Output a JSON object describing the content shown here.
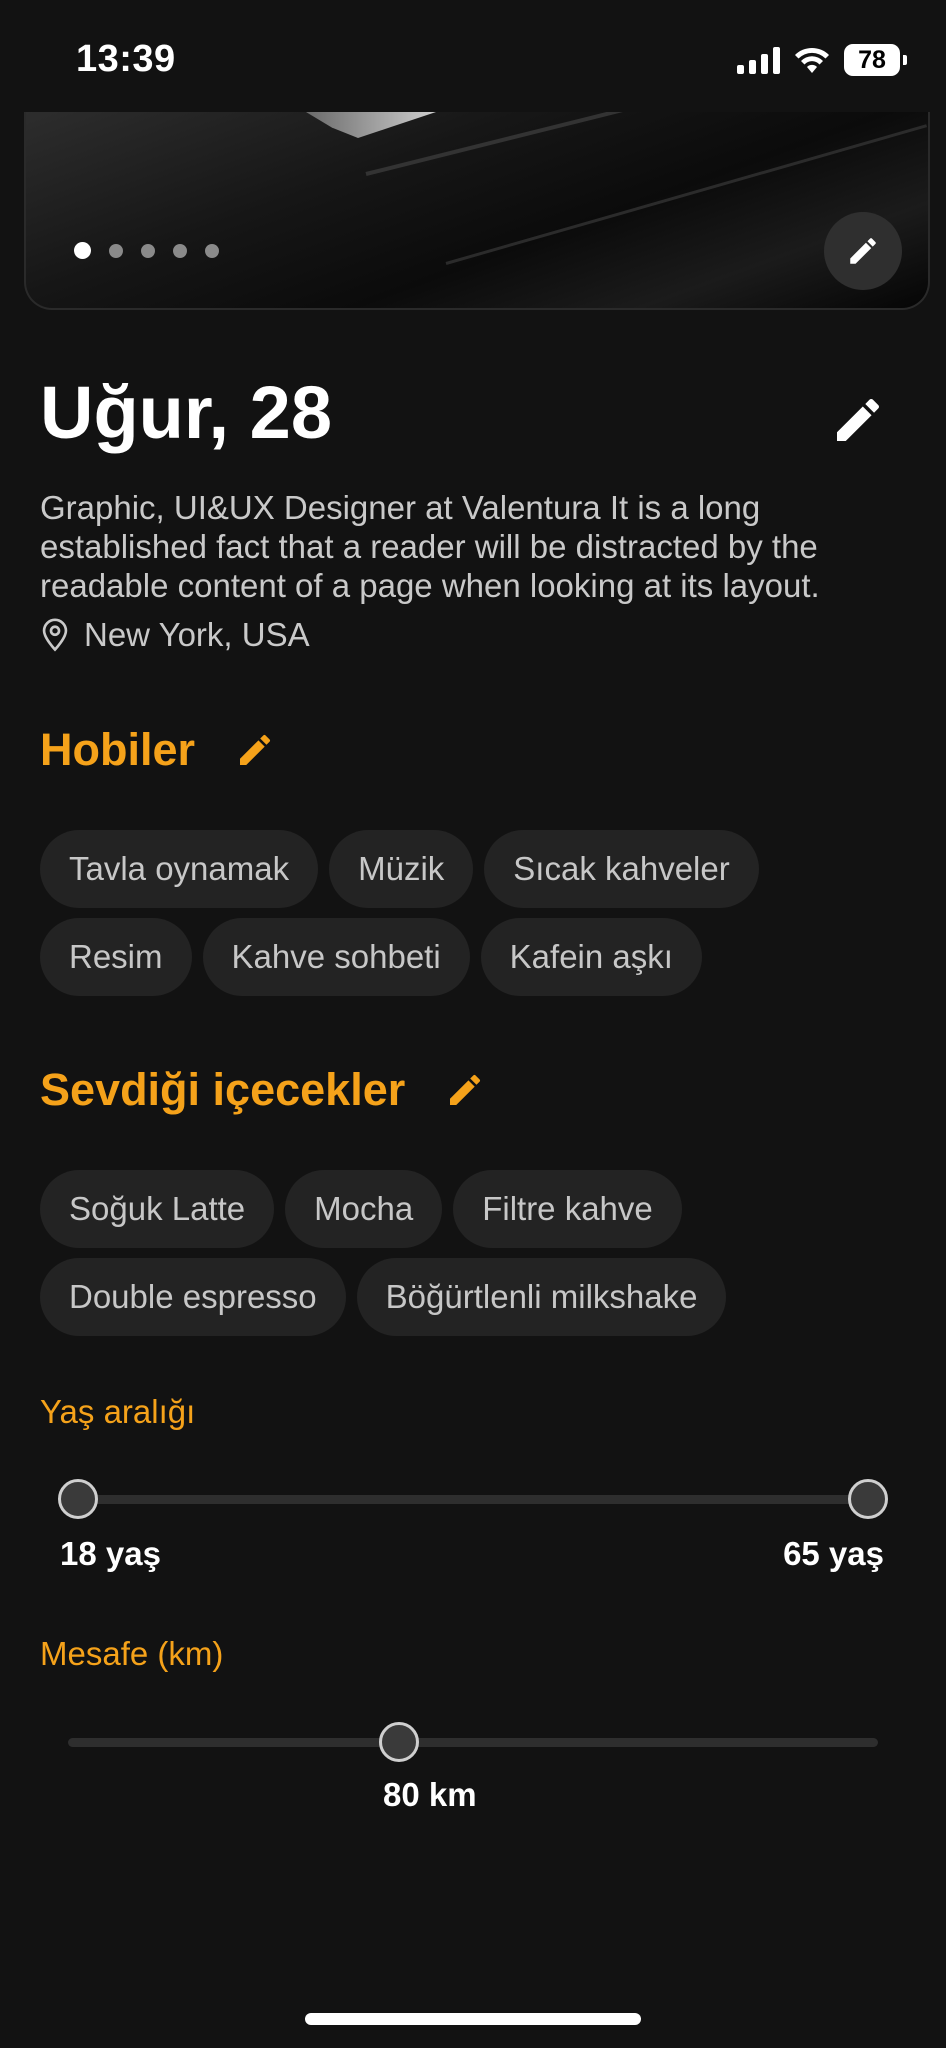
{
  "status_bar": {
    "time": "13:39",
    "battery": "78"
  },
  "photo_gallery": {
    "dot_count": 5,
    "active_index": 0
  },
  "profile": {
    "name_age": "Uğur, 28",
    "bio": "Graphic, UI&UX Designer at Valentura It is a long established fact that a reader will be distracted by the readable content of a page when looking at its layout.",
    "location": "New York, USA"
  },
  "hobbies": {
    "title": "Hobiler",
    "items": [
      "Tavla oynamak",
      "Müzik",
      "Sıcak kahveler",
      "Resim",
      "Kahve sohbeti",
      "Kafein aşkı"
    ]
  },
  "drinks": {
    "title": "Sevdiği içecekler",
    "items": [
      "Soğuk Latte",
      "Mocha",
      "Filtre kahve",
      "Double espresso",
      "Böğürtlenli milkshake"
    ]
  },
  "age_range": {
    "label": "Yaş aralığı",
    "min_label": "18 yaş",
    "max_label": "65 yaş",
    "min": 18,
    "max": 65
  },
  "distance": {
    "label": "Mesafe (km)",
    "value_label": "80 km",
    "value": 80,
    "fill_fraction": 0.41
  },
  "colors": {
    "accent": "#f5a21a",
    "background": "#121212",
    "chip": "#232323"
  }
}
